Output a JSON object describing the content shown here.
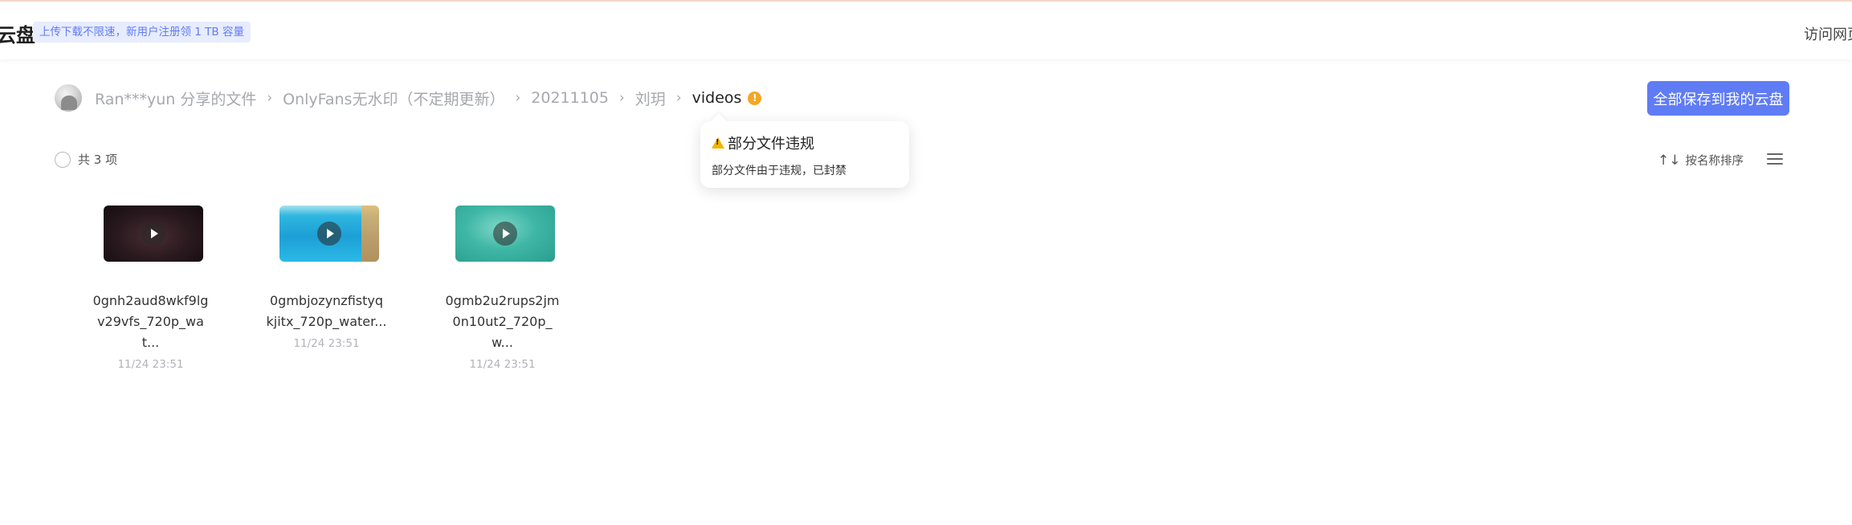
{
  "header": {
    "logo_text": "云盘",
    "promo": "上传下载不限速，新用户注册领 1 TB 容量",
    "visit_link": "访问网页"
  },
  "breadcrumb": {
    "items": [
      "Ran***yun 分享的文件",
      "OnlyFans无水印（不定期更新）",
      "20211105",
      "刘玥"
    ],
    "current": "videos",
    "separator": "›",
    "warning_glyph": "!"
  },
  "actions": {
    "save_all": "全部保存到我的云盘"
  },
  "tooltip": {
    "title": "部分文件违规",
    "body": "部分文件由于违规，已封禁"
  },
  "toolbar": {
    "count_label": "共 3 项",
    "sort_label": "按名称排序",
    "sort_icon": "↑↓"
  },
  "files": [
    {
      "name": "0gnh2aud8wkf9lg v29vfs_720p_wat...",
      "time": "11/24 23:51"
    },
    {
      "name": "0gmbjozynzfistyq kjitx_720p_water...",
      "time": "11/24 23:51"
    },
    {
      "name": "0gmb2u2rups2jm 0n10ut2_720p_w...",
      "time": "11/24 23:51"
    }
  ],
  "colors": {
    "accent": "#5f7cf5",
    "warning": "#f5a623"
  }
}
